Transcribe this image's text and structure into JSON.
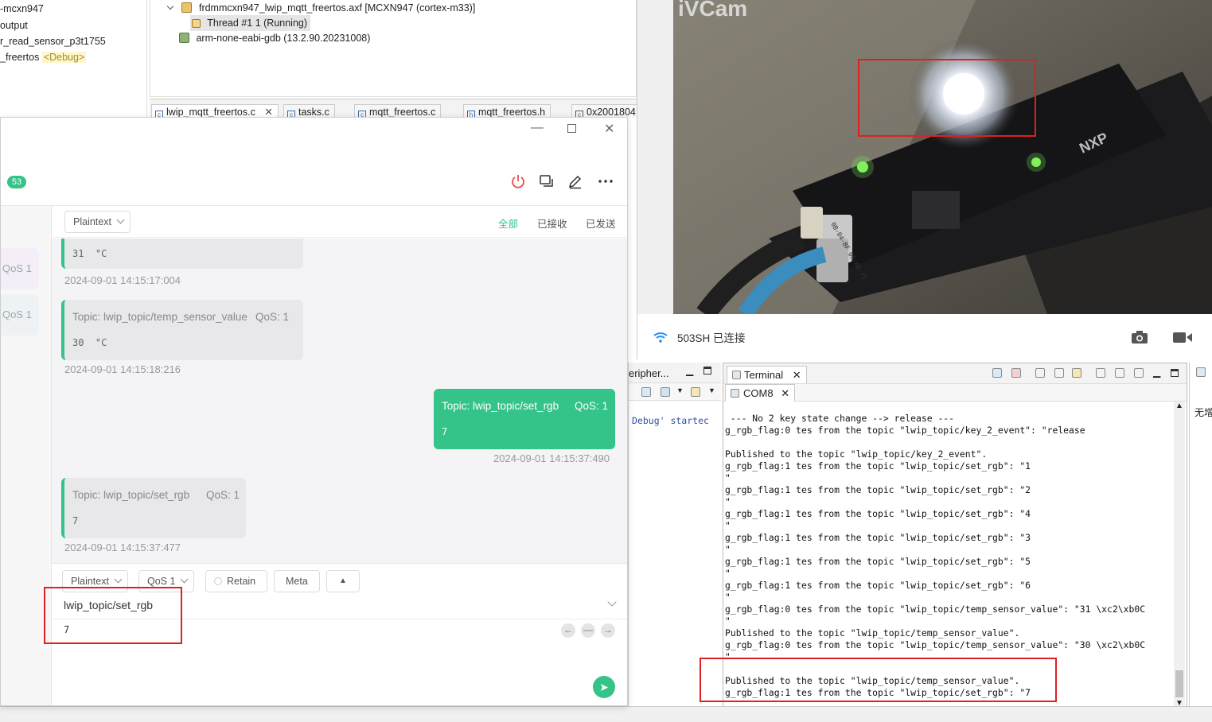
{
  "ide": {
    "project_rows": [
      "-mcxn947",
      "output",
      "r_read_sensor_p3t1755",
      "_freertos"
    ],
    "debug_tag": "<Debug>",
    "tree": {
      "axf": "frdmmcxn947_lwip_mqtt_freertos.axf [MCXN947 (cortex-m33)]",
      "thread": "Thread #1 1 (Running)",
      "gdb": "arm-none-eabi-gdb (13.2.90.20231008)"
    },
    "tabs": [
      "lwip_mqtt_freertos.c",
      "tasks.c",
      "mqtt_freertos.c",
      "mqtt_freertos.h",
      "0x2001804"
    ]
  },
  "mqttx": {
    "badge": "53",
    "payload_format": "Plaintext",
    "filters": [
      "全部",
      "已接收",
      "已发送"
    ],
    "side_qos": [
      "QoS 1",
      "QoS 1"
    ],
    "messages": [
      {
        "topic": "",
        "qos": "",
        "payload": "31  °C",
        "time": "2024-09-01 14:15:17:004",
        "dir": "in"
      },
      {
        "topic": "Topic: lwip_topic/temp_sensor_value",
        "qos": "QoS: 1",
        "payload": "30  °C",
        "time": "2024-09-01 14:15:18:216",
        "dir": "in"
      },
      {
        "topic": "Topic: lwip_topic/set_rgb",
        "qos": "QoS: 1",
        "payload": "7",
        "time": "2024-09-01 14:15:37:490",
        "dir": "out"
      },
      {
        "topic": "Topic: lwip_topic/set_rgb",
        "qos": "QoS: 1",
        "payload": "7",
        "time": "2024-09-01 14:15:37:477",
        "dir": "in"
      }
    ],
    "compose": {
      "format": "Plaintext",
      "qos": "QoS 1",
      "retain": "Retain",
      "meta": "Meta",
      "topic": "lwip_topic/set_rgb",
      "payload": "7"
    }
  },
  "camera": {
    "watermark": "iVCam",
    "board_logo": "NXP",
    "label": "0B-04-BF 08-AD-71",
    "status": "503SH 已连接"
  },
  "eclipse": {
    "peripherals_title": "eripher...",
    "console_snippet": "Debug' startec",
    "terminal_title": "Terminal",
    "com_tab": "COM8",
    "right_text": "无增",
    "terminal_lines": [
      " --- No 2 key state change --> release ---",
      "g_rgb_flag:0 tes from the topic \"lwip_topic/key_2_event\": \"release",
      "",
      "Published to the topic \"lwip_topic/key_2_event\".",
      "g_rgb_flag:1 tes from the topic \"lwip_topic/set_rgb\": \"1",
      "\"",
      "g_rgb_flag:1 tes from the topic \"lwip_topic/set_rgb\": \"2",
      "\"",
      "g_rgb_flag:1 tes from the topic \"lwip_topic/set_rgb\": \"4",
      "\"",
      "g_rgb_flag:1 tes from the topic \"lwip_topic/set_rgb\": \"3",
      "\"",
      "g_rgb_flag:1 tes from the topic \"lwip_topic/set_rgb\": \"5",
      "\"",
      "g_rgb_flag:1 tes from the topic \"lwip_topic/set_rgb\": \"6",
      "\"",
      "g_rgb_flag:0 tes from the topic \"lwip_topic/temp_sensor_value\": \"31 \\xc2\\xb0C",
      "\"",
      "Published to the topic \"lwip_topic/temp_sensor_value\".",
      "g_rgb_flag:0 tes from the topic \"lwip_topic/temp_sensor_value\": \"30 \\xc2\\xb0C",
      "\"",
      "",
      "Published to the topic \"lwip_topic/temp_sensor_value\".",
      "g_rgb_flag:1 tes from the topic \"lwip_topic/set_rgb\": \"7",
      "\""
    ]
  },
  "colors": {
    "accent": "#34c388",
    "highlight_red": "#e02020"
  }
}
